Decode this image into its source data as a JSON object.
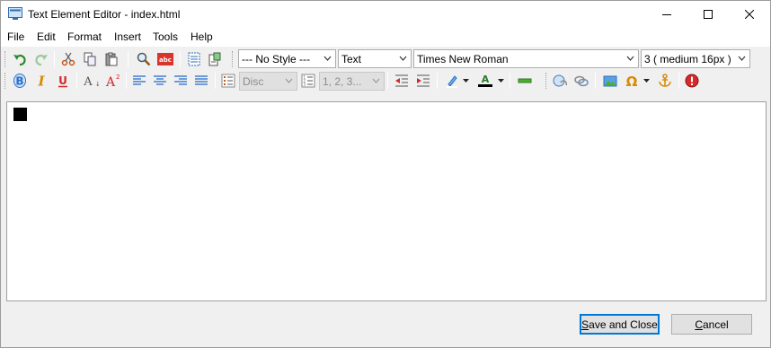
{
  "window": {
    "title": "Text Element Editor - index.html"
  },
  "menu": [
    {
      "label": "File"
    },
    {
      "label": "Edit"
    },
    {
      "label": "Format"
    },
    {
      "label": "Insert"
    },
    {
      "label": "Tools"
    },
    {
      "label": "Help"
    }
  ],
  "toolbar": {
    "style_combo": "--- No Style ---",
    "block_combo": "Text",
    "font_combo": "Times New Roman",
    "size_combo": "3 ( medium 16px )",
    "bullet_combo": "Disc",
    "numbering_combo": "1, 2, 3..."
  },
  "buttons": {
    "save_close": "Save and Close",
    "save_close_mnemonic": "S",
    "save_close_rest": "ave and Close",
    "cancel_mnemonic": "C",
    "cancel_rest": "ancel"
  },
  "colors": {
    "undo": "#2d8a2d",
    "redo": "#9bc89b",
    "bold": "#2a6fc9",
    "italic": "#d98a00",
    "underline": "#d02828",
    "stop": "#d42a2a"
  }
}
